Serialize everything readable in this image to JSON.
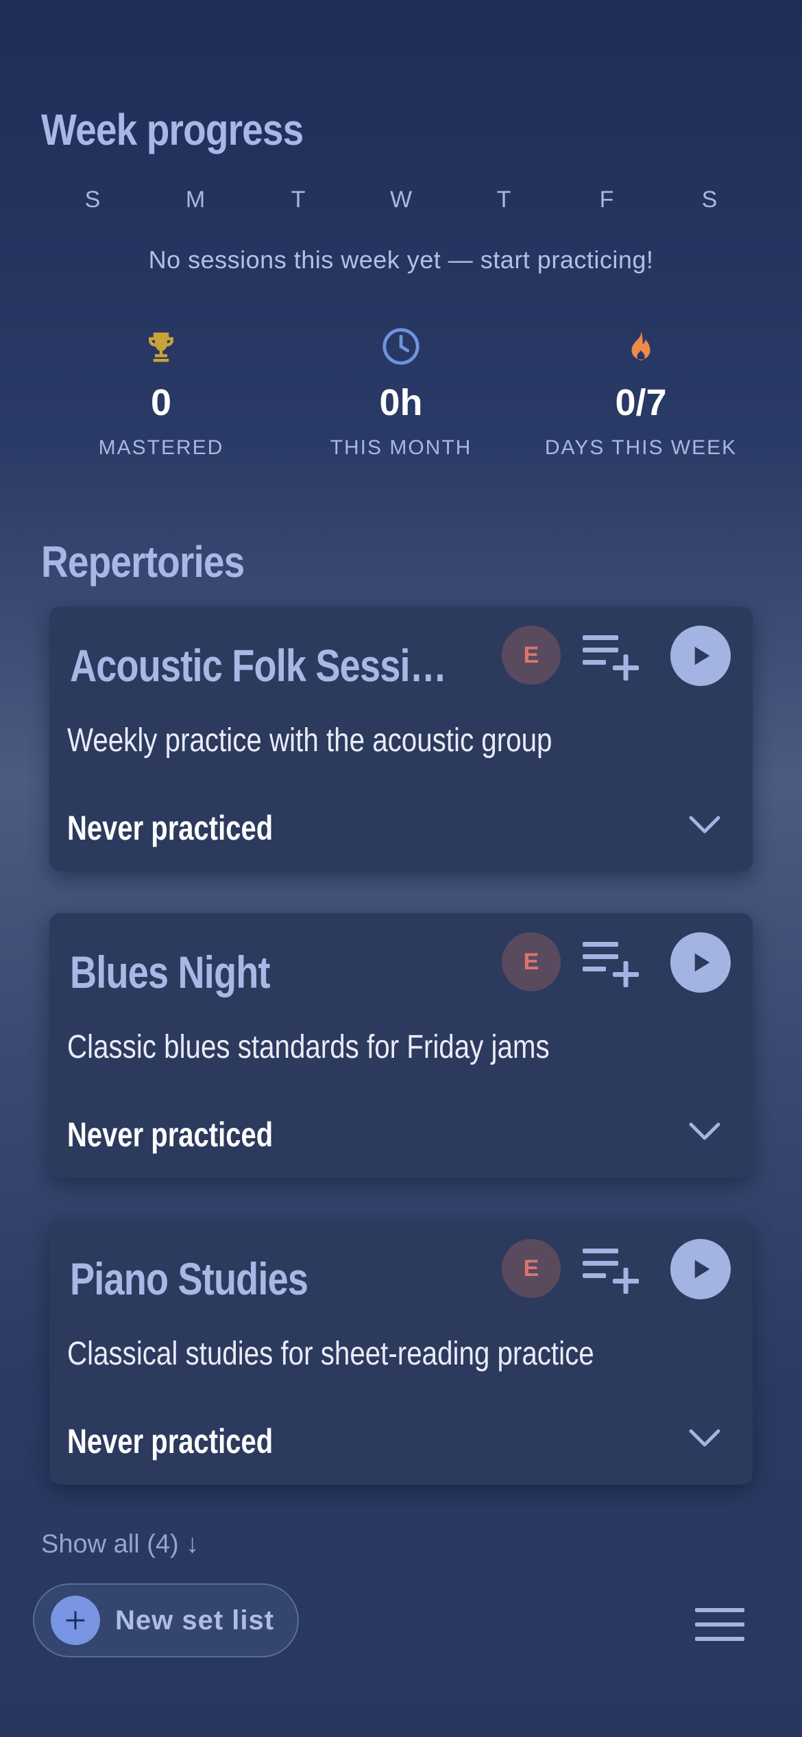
{
  "week": {
    "title": "Week progress",
    "days": [
      "S",
      "M",
      "T",
      "W",
      "T",
      "F",
      "S"
    ],
    "empty_message": "No sessions this week yet — start practicing!"
  },
  "stats": [
    {
      "icon": "trophy-icon",
      "value": "0",
      "label": "MASTERED",
      "color": "#c9a23a"
    },
    {
      "icon": "clock-icon",
      "value": "0h",
      "label": "THIS MONTH",
      "color": "#6f93e0"
    },
    {
      "icon": "flame-icon",
      "value": "0/7",
      "label": "DAYS THIS WEEK",
      "color": "#ef8a4a"
    }
  ],
  "repertories": {
    "title": "Repertories",
    "cards": [
      {
        "title": "Acoustic Folk Sessi…",
        "badge": "E",
        "description": "Weekly practice with the acoustic group",
        "status": "Never practiced"
      },
      {
        "title": "Blues Night",
        "badge": "E",
        "description": "Classic blues standards for Friday jams",
        "status": "Never practiced"
      },
      {
        "title": "Piano Studies",
        "badge": "E",
        "description": "Classical studies for sheet-reading practice",
        "status": "Never practiced"
      }
    ],
    "show_all": "Show all (4) ↓"
  },
  "footer": {
    "new_setlist_label": "New set list"
  }
}
